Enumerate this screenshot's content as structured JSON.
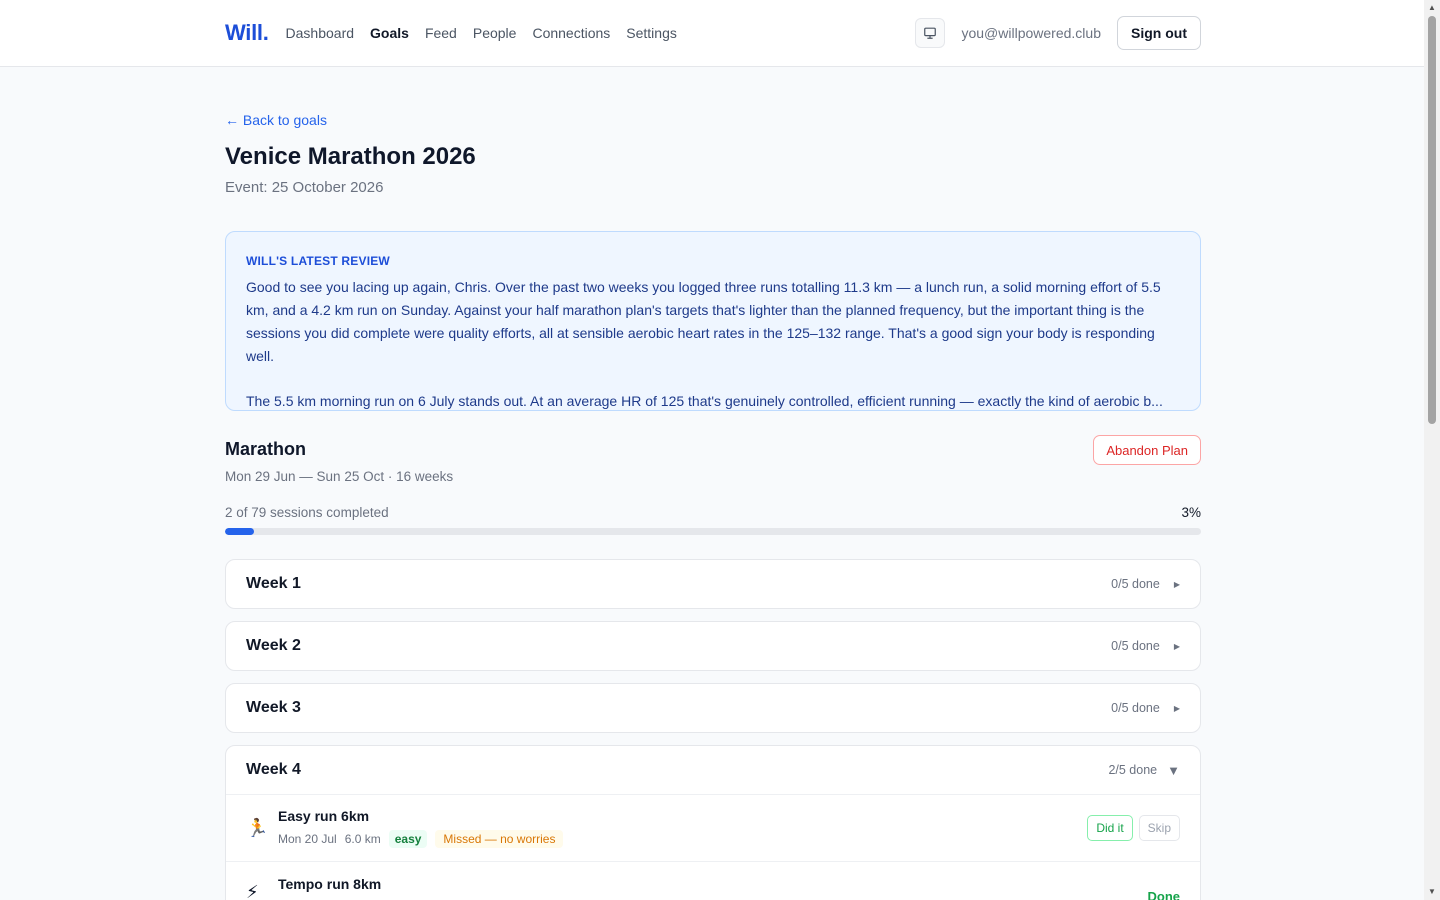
{
  "header": {
    "logo": "Will.",
    "nav": [
      {
        "label": "Dashboard"
      },
      {
        "label": "Goals"
      },
      {
        "label": "Feed"
      },
      {
        "label": "People"
      },
      {
        "label": "Connections"
      },
      {
        "label": "Settings"
      }
    ],
    "active_nav": "Goals",
    "email": "you@willpowered.club",
    "signout": "Sign out",
    "theme_icon": "monitor-icon"
  },
  "goal": {
    "back": "← Back to goals",
    "title": "Venice Marathon 2026",
    "event": "Event: 25 October 2026"
  },
  "review": {
    "label": "WILL'S LATEST REVIEW",
    "p1": "Good to see you lacing up again, Chris. Over the past two weeks you logged three runs totalling 11.3 km — a lunch run, a solid morning effort of 5.5 km, and a 4.2 km run on Sunday. Against your half marathon plan's targets that's lighter than the planned frequency, but the important thing is the sessions you did complete were quality efforts, all at sensible aerobic heart rates in the 125–132 range. That's a good sign your body is responding well.",
    "p2": "The 5.5 km morning run on 6 July stands out. At an average HR of 125 that's genuinely controlled, efficient running — exactly the kind of aerobic b..."
  },
  "plan": {
    "title": "Marathon",
    "dates": "Mon 29 Jun — Sun 25 Oct · 16 weeks",
    "abandon": "Abandon Plan",
    "progress_label": "2 of 79 sessions completed",
    "progress_pct": "3%",
    "progress_fraction": 0.03
  },
  "weeks": [
    {
      "name": "Week 1",
      "count": "0/5 done"
    },
    {
      "name": "Week 2",
      "count": "0/5 done"
    },
    {
      "name": "Week 3",
      "count": "0/5 done"
    },
    {
      "name": "Week 4",
      "count": "2/5 done"
    }
  ],
  "sessions": [
    {
      "icon": "🏃",
      "icon_name": "runner-icon",
      "title": "Easy run 6km",
      "date": "Mon 20 Jul",
      "distance": "6.0 km",
      "tag": "easy",
      "status": "Missed — no worries",
      "did_it": "Did it",
      "skip": "Skip"
    },
    {
      "icon": "⚡",
      "icon_name": "lightning-icon",
      "title": "Tempo run 8km",
      "done": "Done"
    }
  ],
  "colors": {
    "accent": "#2563eb",
    "danger": "#dc2626",
    "success": "#16a34a",
    "warning": "#d97706"
  }
}
